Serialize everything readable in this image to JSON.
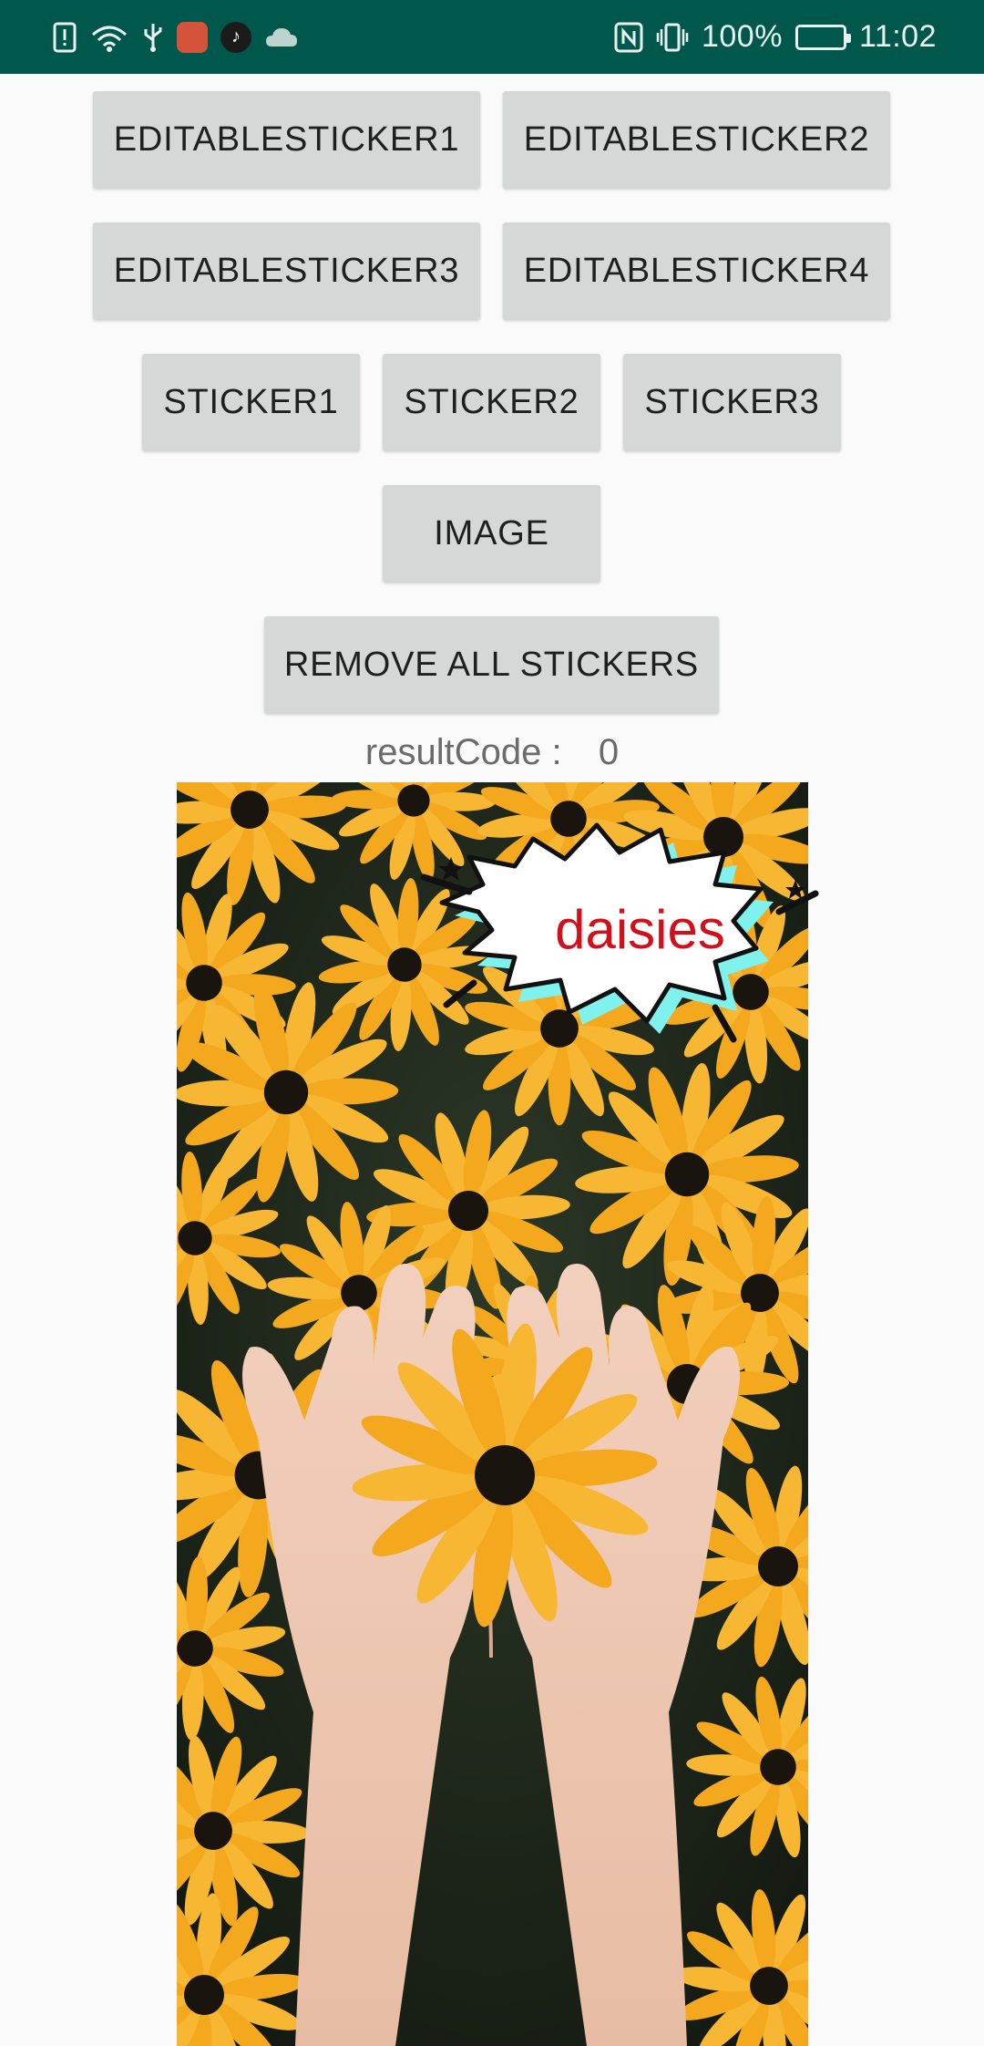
{
  "status_bar": {
    "time": "11:02",
    "battery": "100%",
    "left_icons": [
      "alert-icon",
      "wifi-icon",
      "usb-icon",
      "app-notification-icon",
      "tiktok-icon",
      "cloud-icon"
    ],
    "right_icons": [
      "nfc-icon",
      "vibrate-icon",
      "battery-icon"
    ]
  },
  "buttons": {
    "editable_sticker_1": "EDITABLESTICKER1",
    "editable_sticker_2": "EDITABLESTICKER2",
    "editable_sticker_3": "EDITABLESTICKER3",
    "editable_sticker_4": "EDITABLESTICKER4",
    "sticker_1": "STICKER1",
    "sticker_2": "STICKER2",
    "sticker_3": "STICKER3",
    "image": "IMAGE",
    "remove_all": "REMOVE ALL STICKERS"
  },
  "result": {
    "label": "resultCode :",
    "value": "0"
  },
  "sticker": {
    "text": "daisies",
    "text_color": "#d0101a"
  },
  "colors": {
    "status_bar": "#00574b",
    "button_bg": "#d6d7d7",
    "background": "#fafafa"
  }
}
